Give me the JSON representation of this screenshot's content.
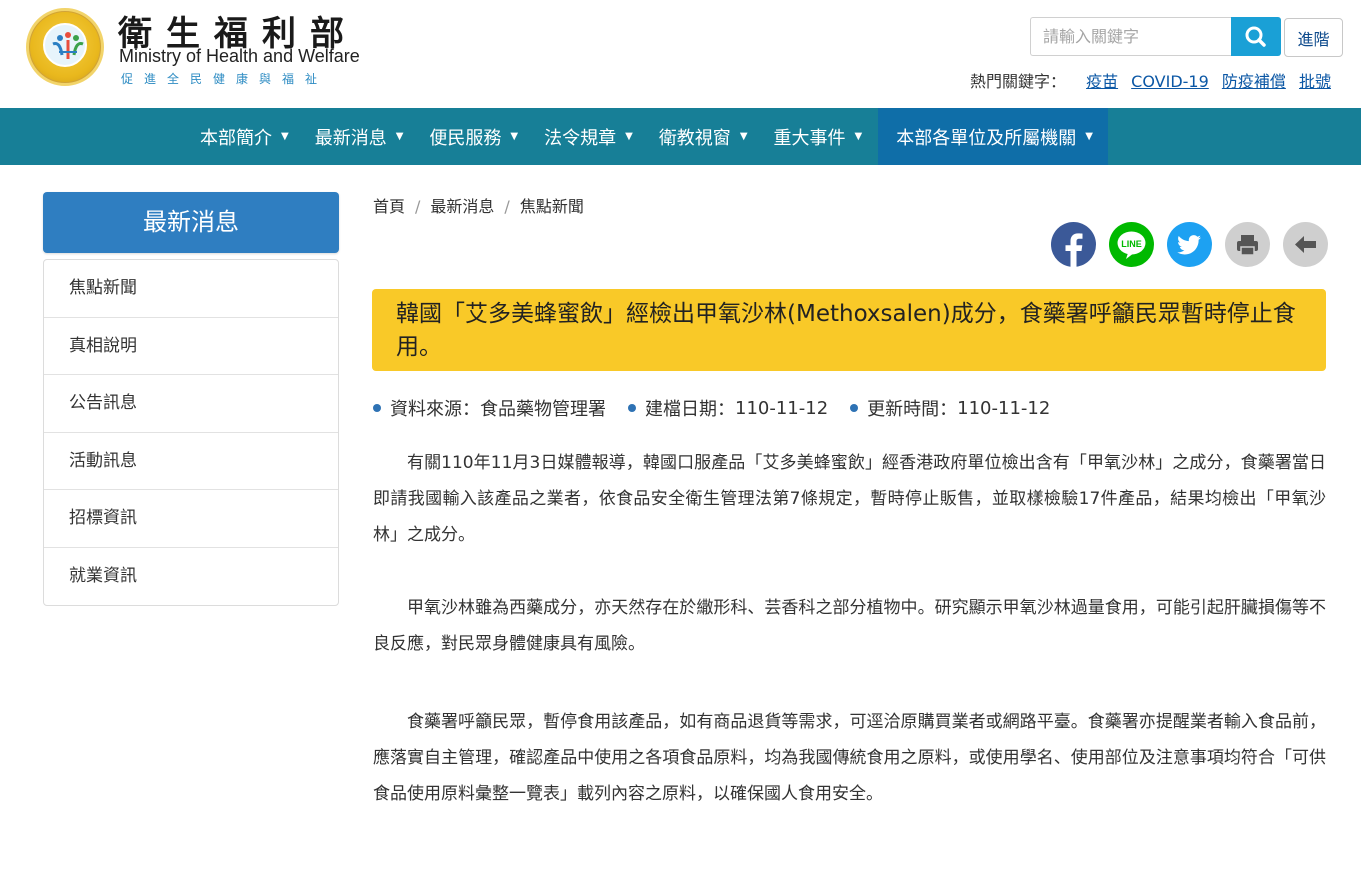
{
  "header": {
    "brand_zh": "衛生福利部",
    "brand_en": "Ministry of Health and Welfare",
    "slogan": "促進全民健康與福祉",
    "search_placeholder": "請輸入關鍵字",
    "advanced_label": "進階",
    "hot_keywords_label": "熱門關鍵字：",
    "hot_keywords": [
      "疫苗",
      "COVID-19",
      "防疫補償",
      "批號"
    ]
  },
  "nav": {
    "items": [
      {
        "label": "本部簡介"
      },
      {
        "label": "最新消息"
      },
      {
        "label": "便民服務"
      },
      {
        "label": "法令規章"
      },
      {
        "label": "衛教視窗"
      },
      {
        "label": "重大事件"
      },
      {
        "label": "本部各單位及所屬機關"
      }
    ]
  },
  "sidebar": {
    "title": "最新消息",
    "items": [
      {
        "label": "焦點新聞"
      },
      {
        "label": "真相說明"
      },
      {
        "label": "公告訊息"
      },
      {
        "label": "活動訊息"
      },
      {
        "label": "招標資訊"
      },
      {
        "label": "就業資訊"
      }
    ]
  },
  "breadcrumb": {
    "items": [
      "首頁",
      "最新消息",
      "焦點新聞"
    ],
    "separator": "/"
  },
  "share": {
    "icons": [
      "facebook-icon",
      "line-icon",
      "twitter-icon",
      "print-icon",
      "back-arrow-icon"
    ],
    "colors": {
      "facebook": "#3b5998",
      "line": "#00b900",
      "twitter": "#1da1f2",
      "print": "#c8c8c8",
      "back": "#c8c8c8"
    }
  },
  "article": {
    "title": "韓國「艾多美蜂蜜飲」經檢出甲氧沙林(Methoxsalen)成分，食藥署呼籲民眾暫時停止食用。",
    "meta": [
      {
        "label": "資料來源：",
        "value": "食品藥物管理署"
      },
      {
        "label": "建檔日期：",
        "value": "110-11-12"
      },
      {
        "label": "更新時間：",
        "value": "110-11-12"
      }
    ],
    "paragraphs": [
      "有關110年11月3日媒體報導，韓國口服產品「艾多美蜂蜜飲」經香港政府單位檢出含有「甲氧沙林」之成分，食藥署當日即請我國輸入該產品之業者，依食品安全衛生管理法第7條規定，暫時停止販售，並取樣檢驗17件產品，結果均檢出「甲氧沙林」之成分。",
      "甲氧沙林雖為西藥成分，亦天然存在於繖形科、芸香科之部分植物中。研究顯示甲氧沙林過量食用，可能引起肝臟損傷等不良反應，對民眾身體健康具有風險。",
      "食藥署呼籲民眾，暫停食用該產品，如有商品退貨等需求，可逕洽原購買業者或網路平臺。食藥署亦提醒業者輸入食品前，應落實自主管理，確認產品中使用之各項食品原料，均為我國傳統食用之原料，或使用學名、使用部位及注意事項均符合「可供食品使用原料彙整一覽表」載列內容之原料，以確保國人食用安全。"
    ]
  },
  "colors": {
    "nav_bg": "#177f97",
    "nav_active": "#0f6ea8",
    "sidebar_title_bg": "#2f7ec1",
    "title_bg": "#f9c928",
    "search_btn": "#1aa0d6",
    "link": "#0b57a5"
  }
}
